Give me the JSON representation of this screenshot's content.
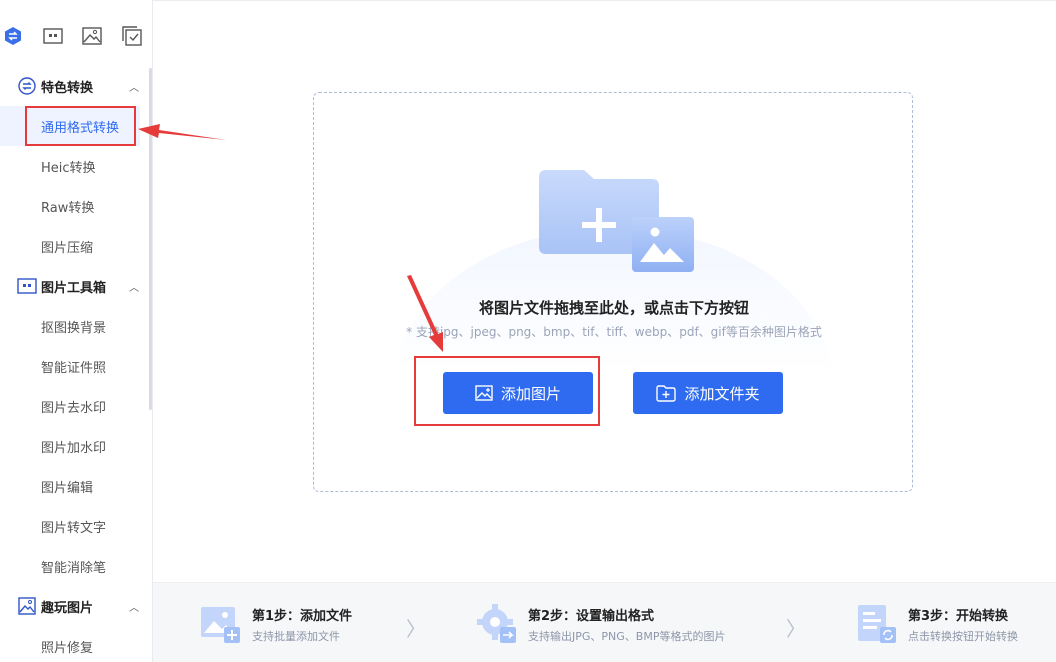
{
  "sidebar": {
    "groups": [
      {
        "label": "特色转换",
        "icon": "convert-icon",
        "items": [
          "通用格式转换",
          "Heic转换",
          "Raw转换",
          "图片压缩"
        ]
      },
      {
        "label": "图片工具箱",
        "icon": "toolbox-icon",
        "items": [
          "抠图换背景",
          "智能证件照",
          "图片去水印",
          "图片加水印",
          "图片编辑",
          "图片转文字",
          "智能消除笔"
        ]
      },
      {
        "label": "趣玩图片",
        "icon": "fun-image-icon",
        "items": [
          "照片修复"
        ]
      }
    ],
    "active_item": "通用格式转换"
  },
  "dropzone": {
    "title": "将图片文件拖拽至此处，或点击下方按钮",
    "hint": "* 支持jpg、jpeg、png、bmp、tif、tiff、webp、pdf、gif等百余种图片格式",
    "add_image_label": "添加图片",
    "add_folder_label": "添加文件夹"
  },
  "steps": [
    {
      "title": "第1步：添加文件",
      "desc": "支持批量添加文件"
    },
    {
      "title": "第2步：设置输出格式",
      "desc": "支持输出JPG、PNG、BMP等格式的图片"
    },
    {
      "title": "第3步：开始转换",
      "desc": "点击转换按钮开始转换"
    }
  ],
  "colors": {
    "accent": "#2f6bf0",
    "annotation": "#e53b3b"
  }
}
